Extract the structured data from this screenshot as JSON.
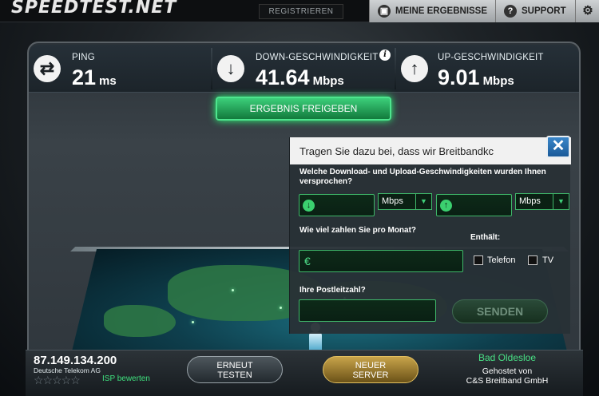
{
  "header": {
    "logo": "SPEEDTEST.NET",
    "register_label": "REGISTRIEREN",
    "results_label": "MEINE ERGEBNISSE",
    "support_label": "SUPPORT"
  },
  "stats": {
    "ping": {
      "label": "PING",
      "value": "21",
      "unit": "ms"
    },
    "download": {
      "label": "DOWN-GESCHWINDIGKEIT",
      "value": "41.64",
      "unit": "Mbps"
    },
    "upload": {
      "label": "UP-GESCHWINDIGKEIT",
      "value": "9.01",
      "unit": "Mbps"
    }
  },
  "share_label": "ERGEBNIS FREIGEBEN",
  "survey": {
    "title": "Tragen Sie dazu bei, dass wir Breitbandkc",
    "q_speed": "Welche Download- und Upload-Geschwindigkeiten wurden Ihnen versprochen?",
    "down_unit": "Mbps",
    "up_unit": "Mbps",
    "q_price": "Wie viel zahlen Sie pro Monat?",
    "currency": "€",
    "included_label": "Enthält:",
    "opt_phone": "Telefon",
    "opt_tv": "TV",
    "q_zip": "Ihre Postleitzahl?",
    "send_label": "SENDEN"
  },
  "footer": {
    "ip": "87.149.134.200",
    "isp": "Deutsche Telekom AG",
    "stars": "☆☆☆☆☆",
    "rate_label": "ISP bewerten",
    "retest_line1": "ERNEUT",
    "retest_line2": "TESTEN",
    "server_line1": "NEUER",
    "server_line2": "SERVER",
    "server_city": "Bad Oldesloe",
    "hosted_line1": "Gehostet von",
    "hosted_line2": "C&S Breitband GmbH"
  },
  "colors": {
    "accent_green": "#3fd07a",
    "server_gold": "#c8a44a",
    "close_blue": "#2a70b5"
  }
}
